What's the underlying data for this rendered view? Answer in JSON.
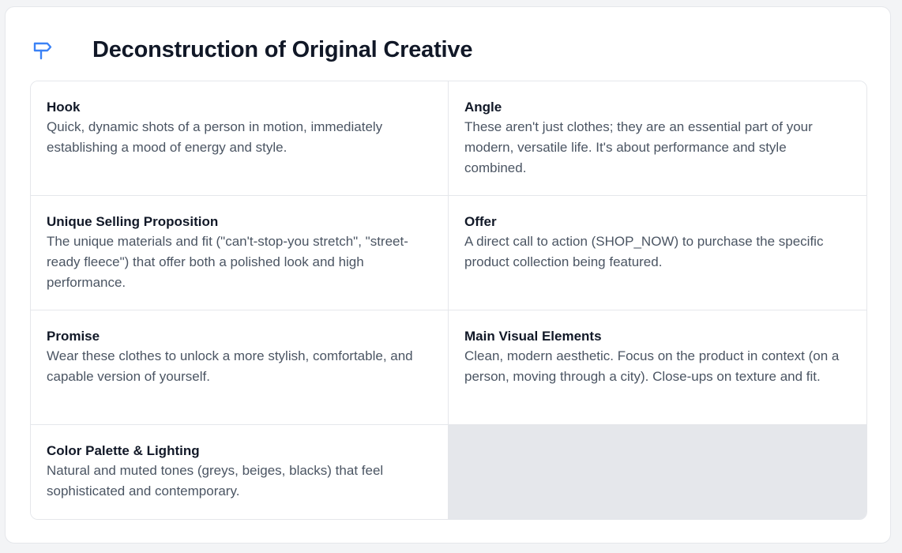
{
  "header": {
    "title": "Deconstruction of Original Creative",
    "icon": "signpost-icon",
    "icon_color": "#3b82f6"
  },
  "sections": [
    {
      "title": "Hook",
      "body": "Quick, dynamic shots of a person in motion, immediately establishing a mood of energy and style."
    },
    {
      "title": "Angle",
      "body": "These aren't just clothes; they are an essential part of your modern, versatile life. It's about performance and style combined."
    },
    {
      "title": "Unique Selling Proposition",
      "body": "The unique materials and fit (\"can't-stop-you stretch\", \"street-ready fleece\") that offer both a polished look and high performance."
    },
    {
      "title": "Offer",
      "body": "A direct call to action (SHOP_NOW) to purchase the specific product collection being featured."
    },
    {
      "title": "Promise",
      "body": "Wear these clothes to unlock a more stylish, comfortable, and capable version of yourself."
    },
    {
      "title": "Main Visual Elements",
      "body": "Clean, modern aesthetic. Focus on the product in context (on a person, moving through a city). Close-ups on texture and fit."
    },
    {
      "title": "Color Palette & Lighting",
      "body": "Natural and muted tones (greys, beiges, blacks) that feel sophisticated and contemporary."
    }
  ]
}
